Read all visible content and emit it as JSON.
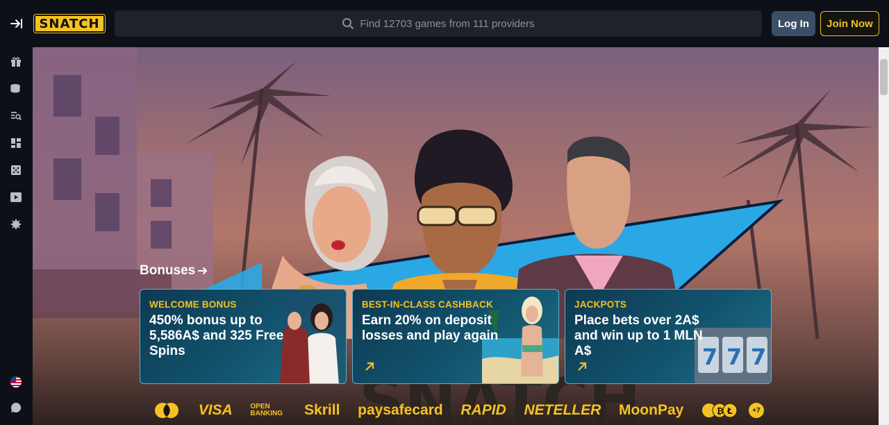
{
  "header": {
    "logo_text": "SNATCH",
    "search_placeholder": "Find 12703 games from 111 providers",
    "login_label": "Log In",
    "join_label": "Join Now"
  },
  "sidebar": {
    "icons": [
      "gift-icon",
      "coins-icon",
      "search-list-icon",
      "grid-icon",
      "dice-icon",
      "play-icon",
      "star-burst-icon",
      "flag-us-icon",
      "chat-icon"
    ]
  },
  "hero": {
    "bonuses_label": "Bonuses"
  },
  "cards": [
    {
      "tag": "WELCOME BONUS",
      "text": "450% bonus up to 5,586A$ and 325 Free Spins"
    },
    {
      "tag": "BEST-IN-CLASS CASHBACK",
      "text": "Earn 20% on deposit losses and play again"
    },
    {
      "tag": "JACKPOTS",
      "text": "Place bets over 2A$ and win up to 1 MLN A$"
    }
  ],
  "payments": [
    "VISA",
    "OPEN BANKING",
    "Skrill",
    "paysafecard",
    "RAPID",
    "NETELLER",
    "MoonPay",
    "+7"
  ],
  "colors": {
    "accent": "#f4c321",
    "login_bg": "#3a4e66",
    "card_border": "#5fb2c9"
  }
}
